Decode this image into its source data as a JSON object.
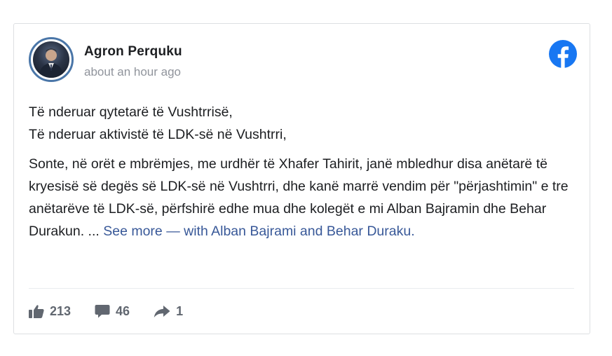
{
  "post": {
    "author": "Agron Perquku",
    "timestamp": "about an hour ago",
    "greeting_line1": "Të nderuar qytetarë të Vushtrrisë,",
    "greeting_line2": "Të nderuar aktivistë të LDK-së në Vushtrri,",
    "body": "Sonte, në orët e mbrëmjes, me urdhër të Xhafer Tahirit, janë mbledhur disa anëtarë të kryesisë së degës së LDK-së në Vushtrri, dhe kanë marrë vendim për \"përjashtimin\" e tre anëtarëve të LDK-së, përfshirë edhe mua dhe kolegët e mi Alban Bajramin dhe Behar Durakun. ...",
    "see_more": "See more",
    "with_prefix": " — with ",
    "tagged_1": "Alban Bajrami",
    "and_text": " and ",
    "tagged_2": "Behar Duraku",
    "end_punct": "."
  },
  "stats": {
    "likes": "213",
    "comments": "46",
    "shares": "1"
  },
  "icons": {
    "like": "thumbs-up-icon",
    "comment": "comment-bubble-icon",
    "share": "share-arrow-icon",
    "brand": "facebook-logo-icon"
  },
  "colors": {
    "facebook_blue": "#1877f2",
    "link": "#385898",
    "muted": "#90949c",
    "stat_gray": "#616770"
  }
}
